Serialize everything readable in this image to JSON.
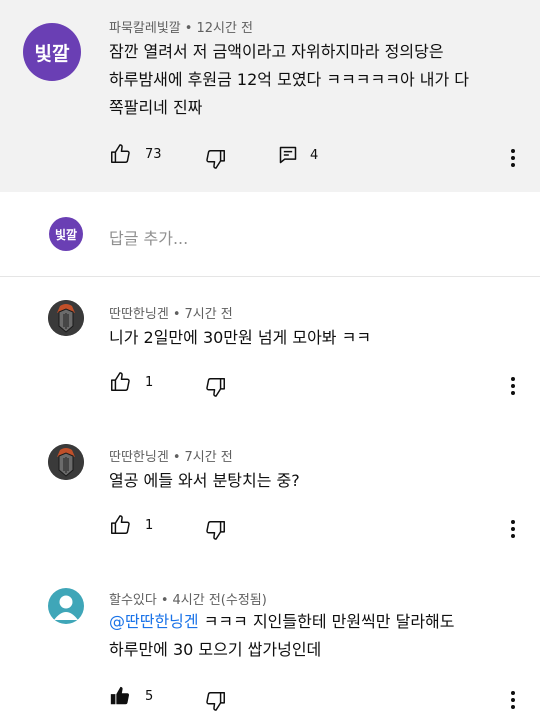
{
  "parent": {
    "avatar_text": "빛깔",
    "author": "파묵칼레빛깔",
    "time": "12시간 전",
    "lines": [
      "잠깐 열려서 저 금액이라고 자위하지마라 정의당은",
      "하루밤새에 후원금 12억 모였다 ㅋㅋㅋㅋㅋ아 내가 다",
      "쪽팔리네 진짜"
    ],
    "likes": "73",
    "replies": "4"
  },
  "reply_box": {
    "avatar_text": "빛깔",
    "placeholder": "답글 추가..."
  },
  "replies": [
    {
      "author": "딴딴한닝겐",
      "time": "7시간 전",
      "text": "니가 2일만에 30만원 넘게 모아봐 ㅋㅋ",
      "likes": "1"
    },
    {
      "author": "딴딴한닝겐",
      "time": "7시간 전",
      "text": "열공 에들 와서 분탕치는 중?",
      "likes": "1"
    },
    {
      "author": "할수있다",
      "time": "4시간 전(수정됨)",
      "mention": "@딴딴한닝겐",
      "line1_rest": "ㅋㅋㅋ 지인들한테 만원씩만 달라해도",
      "line2": "하루만에 30 모으기 쌉가넝인데",
      "likes": "5"
    }
  ],
  "colors": {
    "parent_bg": "#f2f2f2",
    "avatar_purple": "#6a3fb4",
    "mention": "#1a73e8"
  }
}
